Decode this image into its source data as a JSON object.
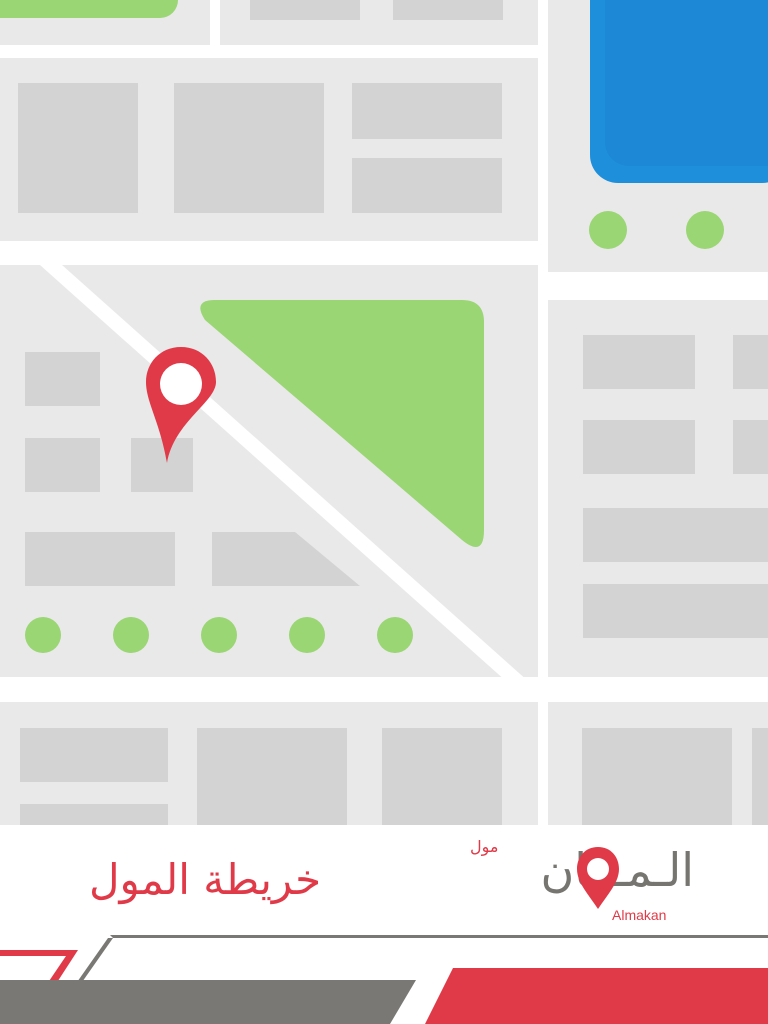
{
  "map": {
    "colors": {
      "background": "#ffffff",
      "block": "#e9e9e9",
      "building": "#d3d3d3",
      "park": "#9ad674",
      "water": "#1e90db",
      "water_inner": "#1a7fd0",
      "pin": "#e03a48"
    },
    "marker": {
      "icon": "location-pin-icon"
    }
  },
  "footer": {
    "title": "خريطة المول",
    "logo": {
      "arabic": "الـمـكان",
      "small": "مول",
      "english": "Almakan"
    },
    "colors": {
      "red": "#e03a48",
      "gray": "#7a7874"
    }
  }
}
